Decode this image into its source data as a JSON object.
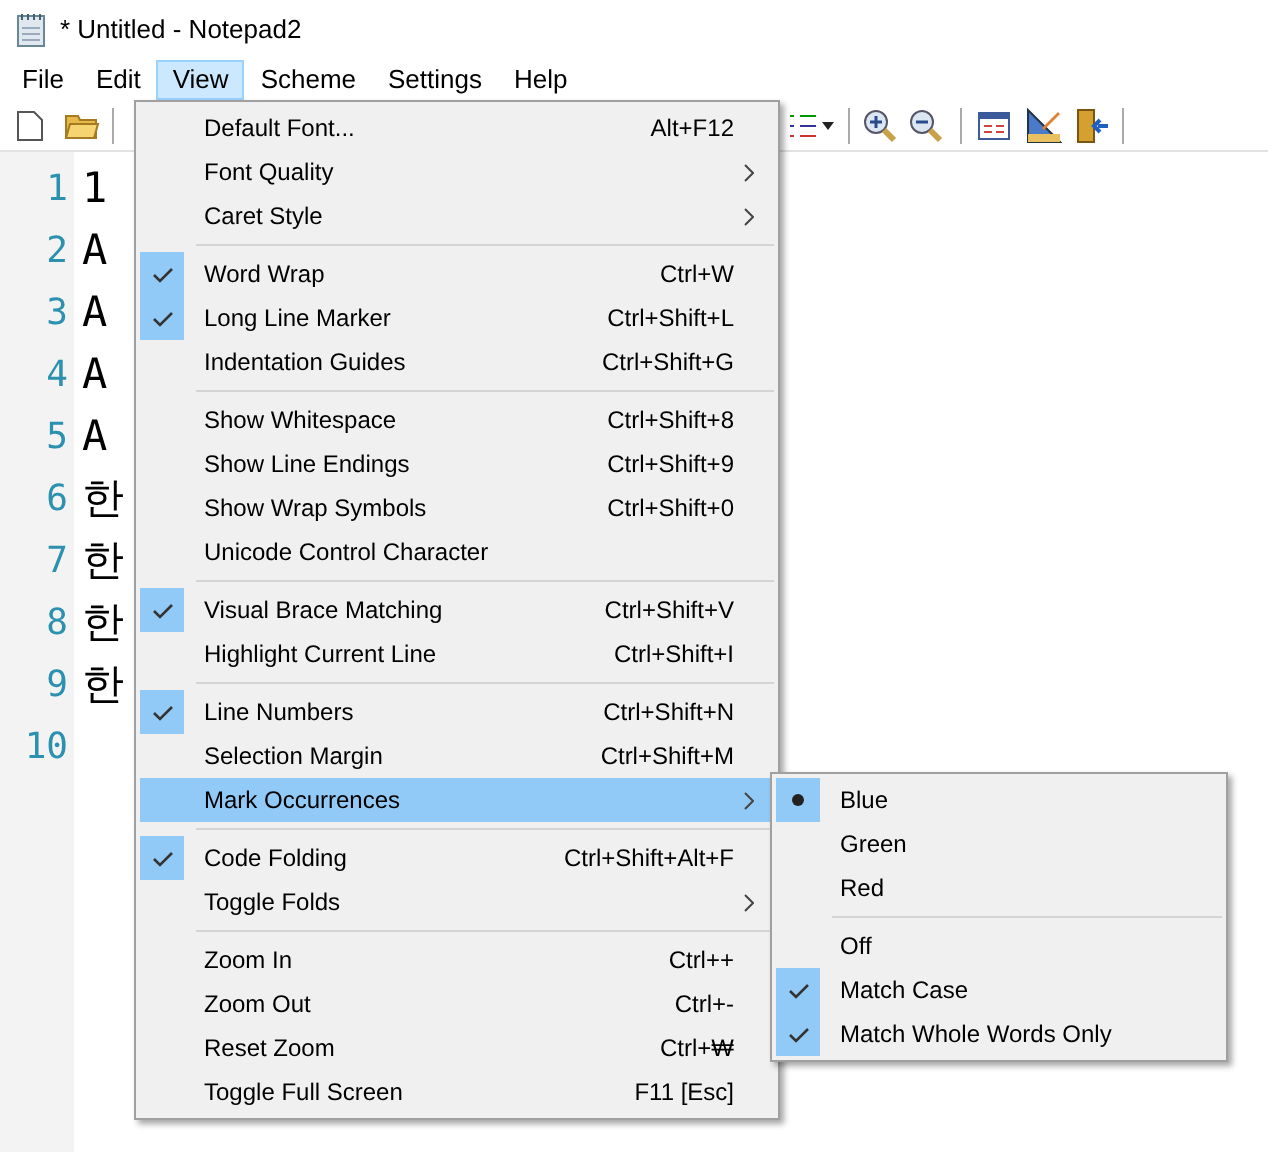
{
  "window": {
    "title": "* Untitled - Notepad2"
  },
  "menubar": [
    {
      "label": "File",
      "selected": false
    },
    {
      "label": "Edit",
      "selected": false
    },
    {
      "label": "View",
      "selected": true
    },
    {
      "label": "Scheme",
      "selected": false
    },
    {
      "label": "Settings",
      "selected": false
    },
    {
      "label": "Help",
      "selected": false
    }
  ],
  "editor": {
    "lines": [
      {
        "number": "1",
        "text": "1"
      },
      {
        "number": "2",
        "text": "A"
      },
      {
        "number": "3",
        "text": "A"
      },
      {
        "number": "4",
        "text": "A"
      },
      {
        "number": "5",
        "text": "A"
      },
      {
        "number": "6",
        "text": "한"
      },
      {
        "number": "7",
        "text": "한"
      },
      {
        "number": "8",
        "text": "한"
      },
      {
        "number": "9",
        "text": "한"
      },
      {
        "number": "10"
      }
    ]
  },
  "view_menu": {
    "items": [
      {
        "kind": "item",
        "label": "Default Font...",
        "shortcut": "Alt+F12",
        "checked": false,
        "submenu": false,
        "selected": false
      },
      {
        "kind": "item",
        "label": "Font Quality",
        "checked": false,
        "submenu": true,
        "selected": false
      },
      {
        "kind": "item",
        "label": "Caret Style",
        "checked": false,
        "submenu": true,
        "selected": false
      },
      {
        "kind": "separator"
      },
      {
        "kind": "item",
        "label": "Word Wrap",
        "shortcut": "Ctrl+W",
        "checked": true,
        "submenu": false,
        "selected": false
      },
      {
        "kind": "item",
        "label": "Long Line Marker",
        "shortcut": "Ctrl+Shift+L",
        "checked": true,
        "submenu": false,
        "selected": false
      },
      {
        "kind": "item",
        "label": "Indentation Guides",
        "shortcut": "Ctrl+Shift+G",
        "checked": false,
        "submenu": false,
        "selected": false
      },
      {
        "kind": "separator"
      },
      {
        "kind": "item",
        "label": "Show Whitespace",
        "shortcut": "Ctrl+Shift+8",
        "checked": false,
        "submenu": false,
        "selected": false
      },
      {
        "kind": "item",
        "label": "Show Line Endings",
        "shortcut": "Ctrl+Shift+9",
        "checked": false,
        "submenu": false,
        "selected": false
      },
      {
        "kind": "item",
        "label": "Show Wrap Symbols",
        "shortcut": "Ctrl+Shift+0",
        "checked": false,
        "submenu": false,
        "selected": false
      },
      {
        "kind": "item",
        "label": "Unicode Control Character",
        "checked": false,
        "submenu": false,
        "selected": false
      },
      {
        "kind": "separator"
      },
      {
        "kind": "item",
        "label": "Visual Brace Matching",
        "shortcut": "Ctrl+Shift+V",
        "checked": true,
        "submenu": false,
        "selected": false
      },
      {
        "kind": "item",
        "label": "Highlight Current Line",
        "shortcut": "Ctrl+Shift+I",
        "checked": false,
        "submenu": false,
        "selected": false
      },
      {
        "kind": "separator"
      },
      {
        "kind": "item",
        "label": "Line Numbers",
        "shortcut": "Ctrl+Shift+N",
        "checked": true,
        "submenu": false,
        "selected": false
      },
      {
        "kind": "item",
        "label": "Selection Margin",
        "shortcut": "Ctrl+Shift+M",
        "checked": false,
        "submenu": false,
        "selected": false
      },
      {
        "kind": "item",
        "label": "Mark Occurrences",
        "checked": false,
        "submenu": true,
        "selected": true
      },
      {
        "kind": "separator"
      },
      {
        "kind": "item",
        "label": "Code Folding",
        "shortcut": "Ctrl+Shift+Alt+F",
        "checked": true,
        "submenu": false,
        "selected": false
      },
      {
        "kind": "item",
        "label": "Toggle Folds",
        "checked": false,
        "submenu": true,
        "selected": false
      },
      {
        "kind": "separator"
      },
      {
        "kind": "item",
        "label": "Zoom In",
        "shortcut": "Ctrl++",
        "checked": false,
        "submenu": false,
        "selected": false
      },
      {
        "kind": "item",
        "label": "Zoom Out",
        "shortcut": "Ctrl+-",
        "checked": false,
        "submenu": false,
        "selected": false
      },
      {
        "kind": "item",
        "label": "Reset Zoom",
        "shortcut": "Ctrl+₩",
        "checked": false,
        "submenu": false,
        "selected": false
      },
      {
        "kind": "item",
        "label": "Toggle Full Screen",
        "shortcut": "F11 [Esc]",
        "checked": false,
        "submenu": false,
        "selected": false
      }
    ]
  },
  "mark_occurrences_menu": {
    "items": [
      {
        "kind": "radio",
        "label": "Blue",
        "checked": true
      },
      {
        "kind": "radio",
        "label": "Green",
        "checked": false
      },
      {
        "kind": "radio",
        "label": "Red",
        "checked": false
      },
      {
        "kind": "separator"
      },
      {
        "kind": "check",
        "label": "Off",
        "checked": false
      },
      {
        "kind": "check",
        "label": "Match Case",
        "checked": true
      },
      {
        "kind": "check",
        "label": "Match Whole Words Only",
        "checked": true
      }
    ]
  }
}
